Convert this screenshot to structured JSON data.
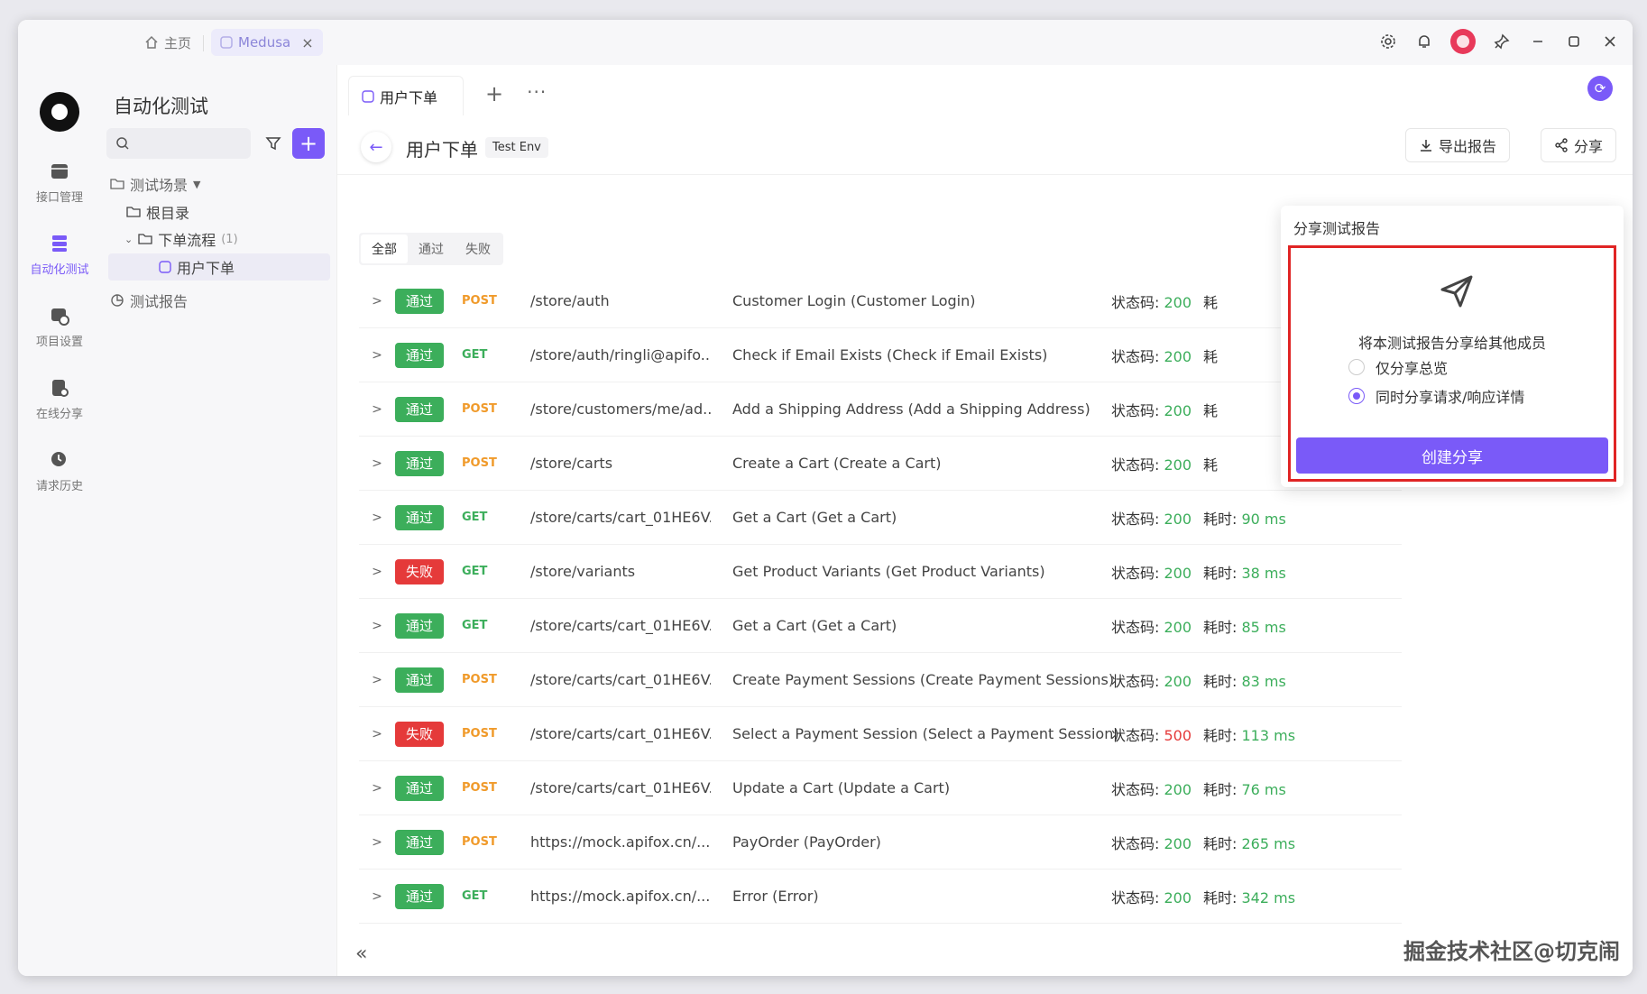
{
  "titlebar": {
    "home_label": "主页",
    "tab_label": "Medusa",
    "tab_close": "×"
  },
  "rail": {
    "items": [
      {
        "label": "接口管理",
        "icon": "api-icon"
      },
      {
        "label": "自动化测试",
        "icon": "automation-icon"
      },
      {
        "label": "项目设置",
        "icon": "settings-icon"
      },
      {
        "label": "在线分享",
        "icon": "share-doc-icon"
      },
      {
        "label": "请求历史",
        "icon": "history-icon"
      }
    ]
  },
  "sidebar": {
    "title": "自动化测试",
    "search_placeholder": "",
    "scenarios_label": "测试场景",
    "root_label": "根目录",
    "folder_label": "下单流程",
    "folder_count": "(1)",
    "case_label": "用户下单",
    "reports_label": "测试报告"
  },
  "main": {
    "tab_label": "用户下单",
    "tab_add": "+",
    "tab_more": "···",
    "page_title": "用户下单",
    "env": "Test Env",
    "export_label": "导出报告",
    "share_label": "分享",
    "filters": [
      "全部",
      "通过",
      "失败"
    ],
    "status_prefix": "状态码: ",
    "time_prefix": "耗时: ",
    "collapse": "«"
  },
  "results": [
    {
      "result": "通过",
      "pass": true,
      "method": "POST",
      "path": "/store/auth",
      "desc": "Customer Login (Customer Login)",
      "code": "200",
      "time": "耗"
    },
    {
      "result": "通过",
      "pass": true,
      "method": "GET",
      "path": "/store/auth/ringli@apifo...",
      "desc": "Check if Email Exists (Check if Email Exists)",
      "code": "200",
      "time": "耗"
    },
    {
      "result": "通过",
      "pass": true,
      "method": "POST",
      "path": "/store/customers/me/ad...",
      "desc": "Add a Shipping Address (Add a Shipping Address)",
      "code": "200",
      "time": "耗"
    },
    {
      "result": "通过",
      "pass": true,
      "method": "POST",
      "path": "/store/carts",
      "desc": "Create a Cart (Create a Cart)",
      "code": "200",
      "time": "耗"
    },
    {
      "result": "通过",
      "pass": true,
      "method": "GET",
      "path": "/store/carts/cart_01HE6V...",
      "desc": "Get a Cart (Get a Cart)",
      "code": "200",
      "time": "90 ms"
    },
    {
      "result": "失败",
      "pass": false,
      "method": "GET",
      "path": "/store/variants",
      "desc": "Get Product Variants (Get Product Variants)",
      "code": "200",
      "time": "38 ms"
    },
    {
      "result": "通过",
      "pass": true,
      "method": "GET",
      "path": "/store/carts/cart_01HE6V...",
      "desc": "Get a Cart (Get a Cart)",
      "code": "200",
      "time": "85 ms"
    },
    {
      "result": "通过",
      "pass": true,
      "method": "POST",
      "path": "/store/carts/cart_01HE6V...",
      "desc": "Create Payment Sessions (Create Payment Sessions)",
      "code": "200",
      "time": "83 ms"
    },
    {
      "result": "失败",
      "pass": false,
      "method": "POST",
      "path": "/store/carts/cart_01HE6V...",
      "desc": "Select a Payment Session (Select a Payment Session)",
      "code": "500",
      "time": "113 ms"
    },
    {
      "result": "通过",
      "pass": true,
      "method": "POST",
      "path": "/store/carts/cart_01HE6V...",
      "desc": "Update a Cart (Update a Cart)",
      "code": "200",
      "time": "76 ms"
    },
    {
      "result": "通过",
      "pass": true,
      "method": "POST",
      "path": "https://mock.apifox.cn/...",
      "desc": "PayOrder (PayOrder)",
      "code": "200",
      "time": "265 ms"
    },
    {
      "result": "通过",
      "pass": true,
      "method": "GET",
      "path": "https://mock.apifox.cn/...",
      "desc": "Error (Error)",
      "code": "200",
      "time": "342 ms"
    }
  ],
  "share_popover": {
    "title": "分享测试报告",
    "text": "将本测试报告分享给其他成员",
    "option_summary": "仅分享总览",
    "option_details": "同时分享请求/响应详情",
    "selected": "details",
    "create_label": "创建分享"
  },
  "watermark": "掘金技术社区@切克闹",
  "colors": {
    "accent": "#7a5af8",
    "pass": "#3cae5b",
    "fail": "#e53a3a",
    "post": "#f09a2a",
    "highlight_border": "#e02424"
  }
}
